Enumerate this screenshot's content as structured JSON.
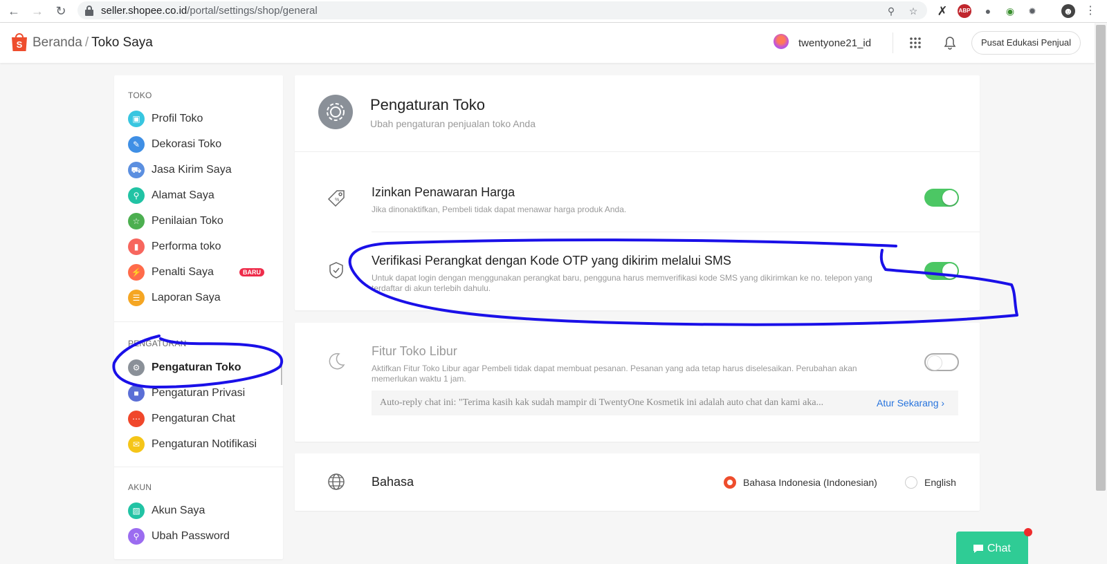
{
  "browser": {
    "url_host": "seller.shopee.co.id",
    "url_path": "/portal/settings/shop/general"
  },
  "header": {
    "breadcrumb_home": "Beranda",
    "breadcrumb_sep": "/",
    "breadcrumb_current": "Toko Saya",
    "username": "twentyone21_id",
    "edu_button": "Pusat Edukasi Penjual"
  },
  "sidebar": {
    "section_toko": "TOKO",
    "section_pengaturan": "PENGATURAN",
    "section_akun": "AKUN",
    "toko_items": [
      {
        "label": "Profil Toko",
        "icon": "store-profile-icon",
        "color": "#38c6e0"
      },
      {
        "label": "Dekorasi Toko",
        "icon": "brush-icon",
        "color": "#3f8fe5"
      },
      {
        "label": "Jasa Kirim Saya",
        "icon": "truck-icon",
        "color": "#5b8fe0"
      },
      {
        "label": "Alamat Saya",
        "icon": "location-icon",
        "color": "#21c3a4"
      },
      {
        "label": "Penilaian Toko",
        "icon": "star-icon",
        "color": "#4caf50"
      },
      {
        "label": "Performa toko",
        "icon": "chart-icon",
        "color": "#f7665e"
      },
      {
        "label": "Penalti Saya",
        "icon": "penalty-icon",
        "color": "#ff6b4a"
      },
      {
        "label": "Laporan Saya",
        "icon": "report-icon",
        "color": "#f5a623"
      }
    ],
    "badge_new": "BARU",
    "pengaturan_items": [
      {
        "label": "Pengaturan Toko",
        "icon": "gear-icon",
        "color": "#8a9098"
      },
      {
        "label": "Pengaturan Privasi",
        "icon": "privacy-icon",
        "color": "#5b6fd6"
      },
      {
        "label": "Pengaturan Chat",
        "icon": "chat-icon",
        "color": "#f0472b"
      },
      {
        "label": "Pengaturan Notifikasi",
        "icon": "notification-icon",
        "color": "#f5c518"
      }
    ],
    "akun_items": [
      {
        "label": "Akun Saya",
        "icon": "account-icon",
        "color": "#21c3a4"
      },
      {
        "label": "Ubah Password",
        "icon": "key-icon",
        "color": "#9b6cf0"
      }
    ]
  },
  "main": {
    "title": "Pengaturan Toko",
    "subtitle": "Ubah pengaturan penjualan toko Anda",
    "settings": [
      {
        "title": "Izinkan Penawaran Harga",
        "desc": "Jika dinonaktifkan, Pembeli tidak dapat menawar harga produk Anda.",
        "enabled": true
      },
      {
        "title": "Verifikasi Perangkat dengan Kode OTP yang dikirim melalui SMS",
        "desc": "Untuk dapat login dengan menggunakan perangkat baru, pengguna harus memverifikasi kode SMS yang dikirimkan ke no. telepon yang terdaftar di akun terlebih dahulu.",
        "enabled": true
      }
    ],
    "vacation": {
      "title": "Fitur Toko Libur",
      "desc": "Aktifkan Fitur Toko Libur agar Pembeli tidak dapat membuat pesanan. Pesanan yang ada tetap harus diselesaikan. Perubahan akan memerlukan waktu 1 jam.",
      "enabled": false,
      "auto_reply": "Auto-reply chat ini: \"Terima kasih kak sudah mampir di TwentyOne Kosmetik ini adalah auto chat dan kami aka...",
      "link": "Atur Sekarang"
    },
    "language": {
      "title": "Bahasa",
      "options": [
        "Bahasa Indonesia (Indonesian)",
        "English"
      ],
      "selected": "Bahasa Indonesia (Indonesian)"
    }
  },
  "chat": {
    "label": "Chat"
  },
  "colors": {
    "brand": "#ee4d2d",
    "toggle_on": "#4cc764",
    "link": "#2673dd",
    "annotation": "#1a10e8",
    "chat": "#2fcc95"
  }
}
